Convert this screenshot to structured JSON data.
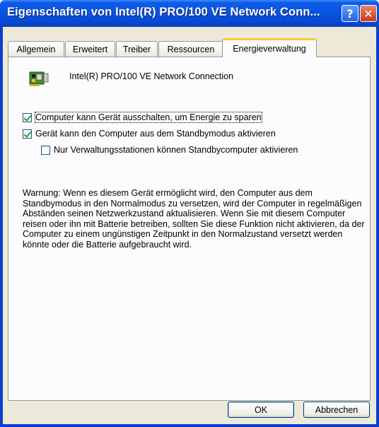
{
  "window": {
    "title": "Eigenschaften von Intel(R) PRO/100 VE Network Conn...",
    "help_glyph": "?",
    "close_glyph": "✕"
  },
  "tabs": [
    {
      "label": "Allgemein",
      "active": false
    },
    {
      "label": "Erweitert",
      "active": false
    },
    {
      "label": "Treiber",
      "active": false
    },
    {
      "label": "Ressourcen",
      "active": false
    },
    {
      "label": "Energieverwaltung",
      "active": true
    }
  ],
  "device": {
    "name": "Intel(R) PRO/100 VE Network Connection",
    "icon": "network-card-icon"
  },
  "options": [
    {
      "label": "Computer kann Gerät ausschalten, um Energie zu sparen",
      "checked": true,
      "focused": true
    },
    {
      "label": "Gerät kann den Computer aus dem Standbymodus aktivieren",
      "checked": true,
      "focused": false
    },
    {
      "label": "Nur Verwaltungsstationen können Standbycomputer aktivieren",
      "checked": false,
      "focused": false
    }
  ],
  "warning_text": "Warnung: Wenn es diesem Gerät ermöglicht wird, den Computer aus dem Standbymodus in den Normalmodus zu versetzen, wird der Computer in regelmäßigen Abständen seinen Netzwerkzustand aktualisieren. Wenn Sie mit diesem Computer reisen oder ihn mit Batterie betreiben, sollten Sie diese Funktion nicht aktivieren, da der Computer zu einem ungünstigen Zeitpunkt in den Normalzustand versetzt werden könnte oder die Batterie aufgebraucht wird.",
  "buttons": {
    "ok": "OK",
    "cancel": "Abbrechen"
  },
  "colors": {
    "titlebar": "#0a55e0",
    "dialog_bg": "#ece9d8",
    "active_tab_accent": "#ffc83c",
    "checkmark": "#21a121"
  }
}
